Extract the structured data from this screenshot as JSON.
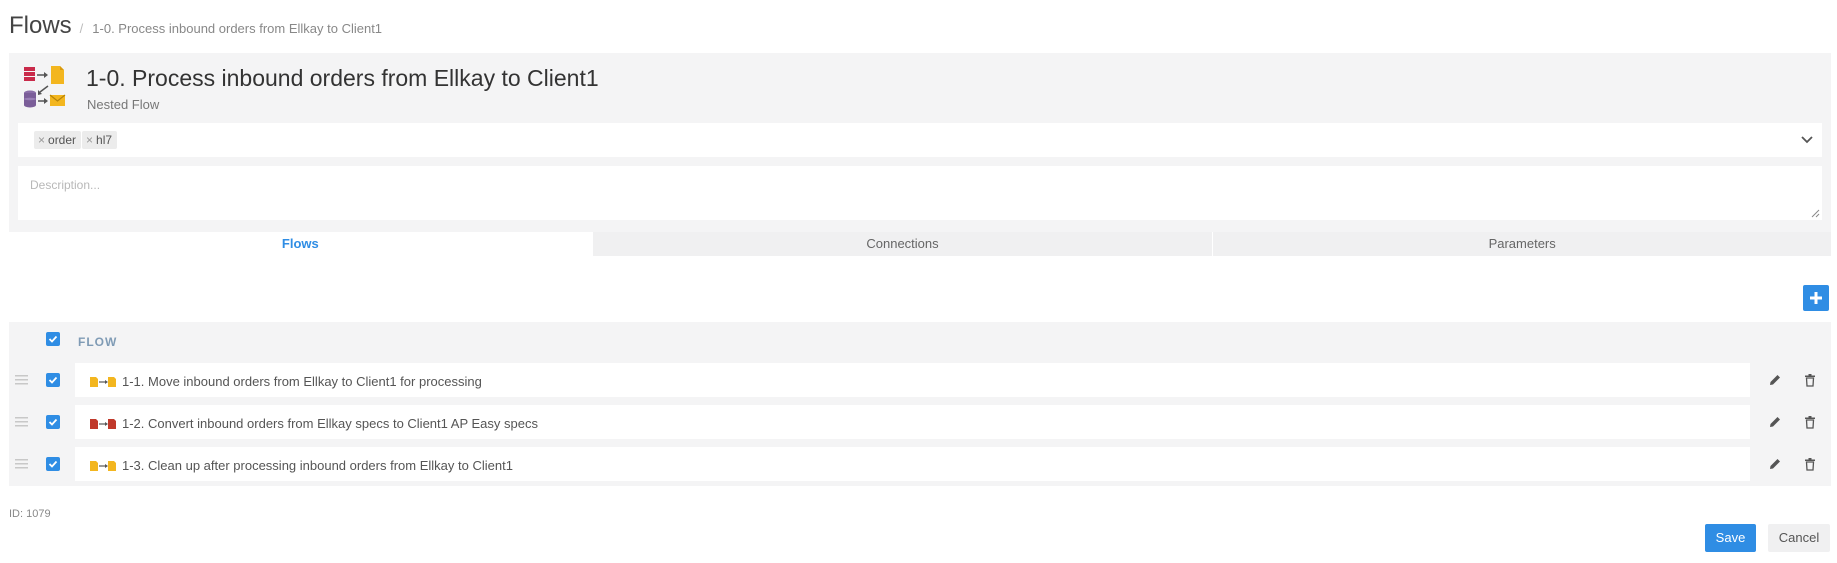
{
  "breadcrumb": {
    "root": "Flows",
    "separator": "/",
    "current": "1-0. Process inbound orders from Ellkay to Client1"
  },
  "flow": {
    "title": "1-0. Process inbound orders from Ellkay to Client1",
    "type": "Nested Flow",
    "icon": "nested-flow-icon"
  },
  "tags": [
    {
      "label": "order",
      "remove": "×"
    },
    {
      "label": "hl7",
      "remove": "×"
    }
  ],
  "description": {
    "placeholder": "Description...",
    "value": ""
  },
  "tabs": [
    {
      "label": "Flows",
      "active": true
    },
    {
      "label": "Connections",
      "active": false
    },
    {
      "label": "Parameters",
      "active": false
    }
  ],
  "table": {
    "header": "FLOW",
    "rows": [
      {
        "label": "1-1. Move inbound orders from Ellkay to Client1 for processing",
        "icon": "file-move-icon",
        "checked": true
      },
      {
        "label": "1-2. Convert inbound orders from Ellkay specs to Client1 AP Easy specs",
        "icon": "file-convert-icon",
        "checked": true
      },
      {
        "label": "1-3. Clean up after processing inbound orders from Ellkay to Client1",
        "icon": "file-move-icon",
        "checked": true
      }
    ]
  },
  "footer": {
    "id_label": "ID: 1079",
    "save": "Save",
    "cancel": "Cancel"
  },
  "colors": {
    "accent": "#2f8de4",
    "panel": "#f4f4f5",
    "header_text": "#7f9bb5"
  }
}
